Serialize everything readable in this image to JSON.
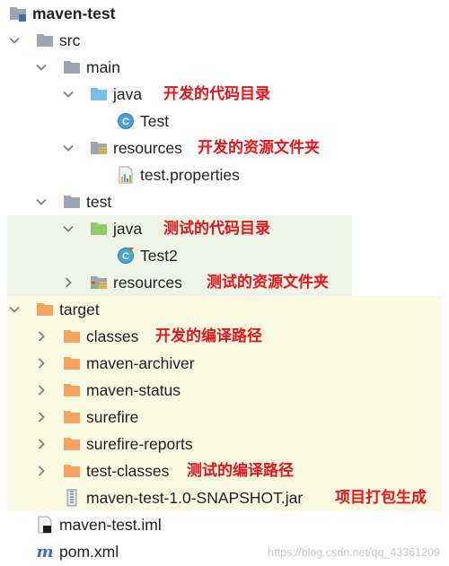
{
  "tree": {
    "root": "maven-test",
    "src": "src",
    "main": "main",
    "main_java": "java",
    "test_class": "Test",
    "main_resources": "resources",
    "test_properties": "test.properties",
    "test": "test",
    "test_java": "java",
    "test2_class": "Test2",
    "test_resources": "resources",
    "target": "target",
    "classes": "classes",
    "maven_archiver": "maven-archiver",
    "maven_status": "maven-status",
    "surefire": "surefire",
    "surefire_reports": "surefire-reports",
    "test_classes": "test-classes",
    "jar": "maven-test-1.0-SNAPSHOT.jar",
    "iml": "maven-test.iml",
    "pom": "pom.xml"
  },
  "annotations": {
    "main_java": "开发的代码目录",
    "main_resources": "开发的资源文件夹",
    "test_java": "测试的代码目录",
    "test_resources": "测试的资源文件夹",
    "classes": "开发的编译路径",
    "test_classes": "测试的编译路径",
    "jar": "项目打包生成"
  },
  "watermark": "https://blog.csdn.net/qq_43361209",
  "colors": {
    "annotation": "#e8141a",
    "folder_grey": "#9aa7b0",
    "folder_blue": "#79c0e6",
    "folder_green": "#8fca6e",
    "folder_orange": "#f4a460",
    "test_bg": "#eef5e6",
    "target_bg": "#fbfae3"
  }
}
